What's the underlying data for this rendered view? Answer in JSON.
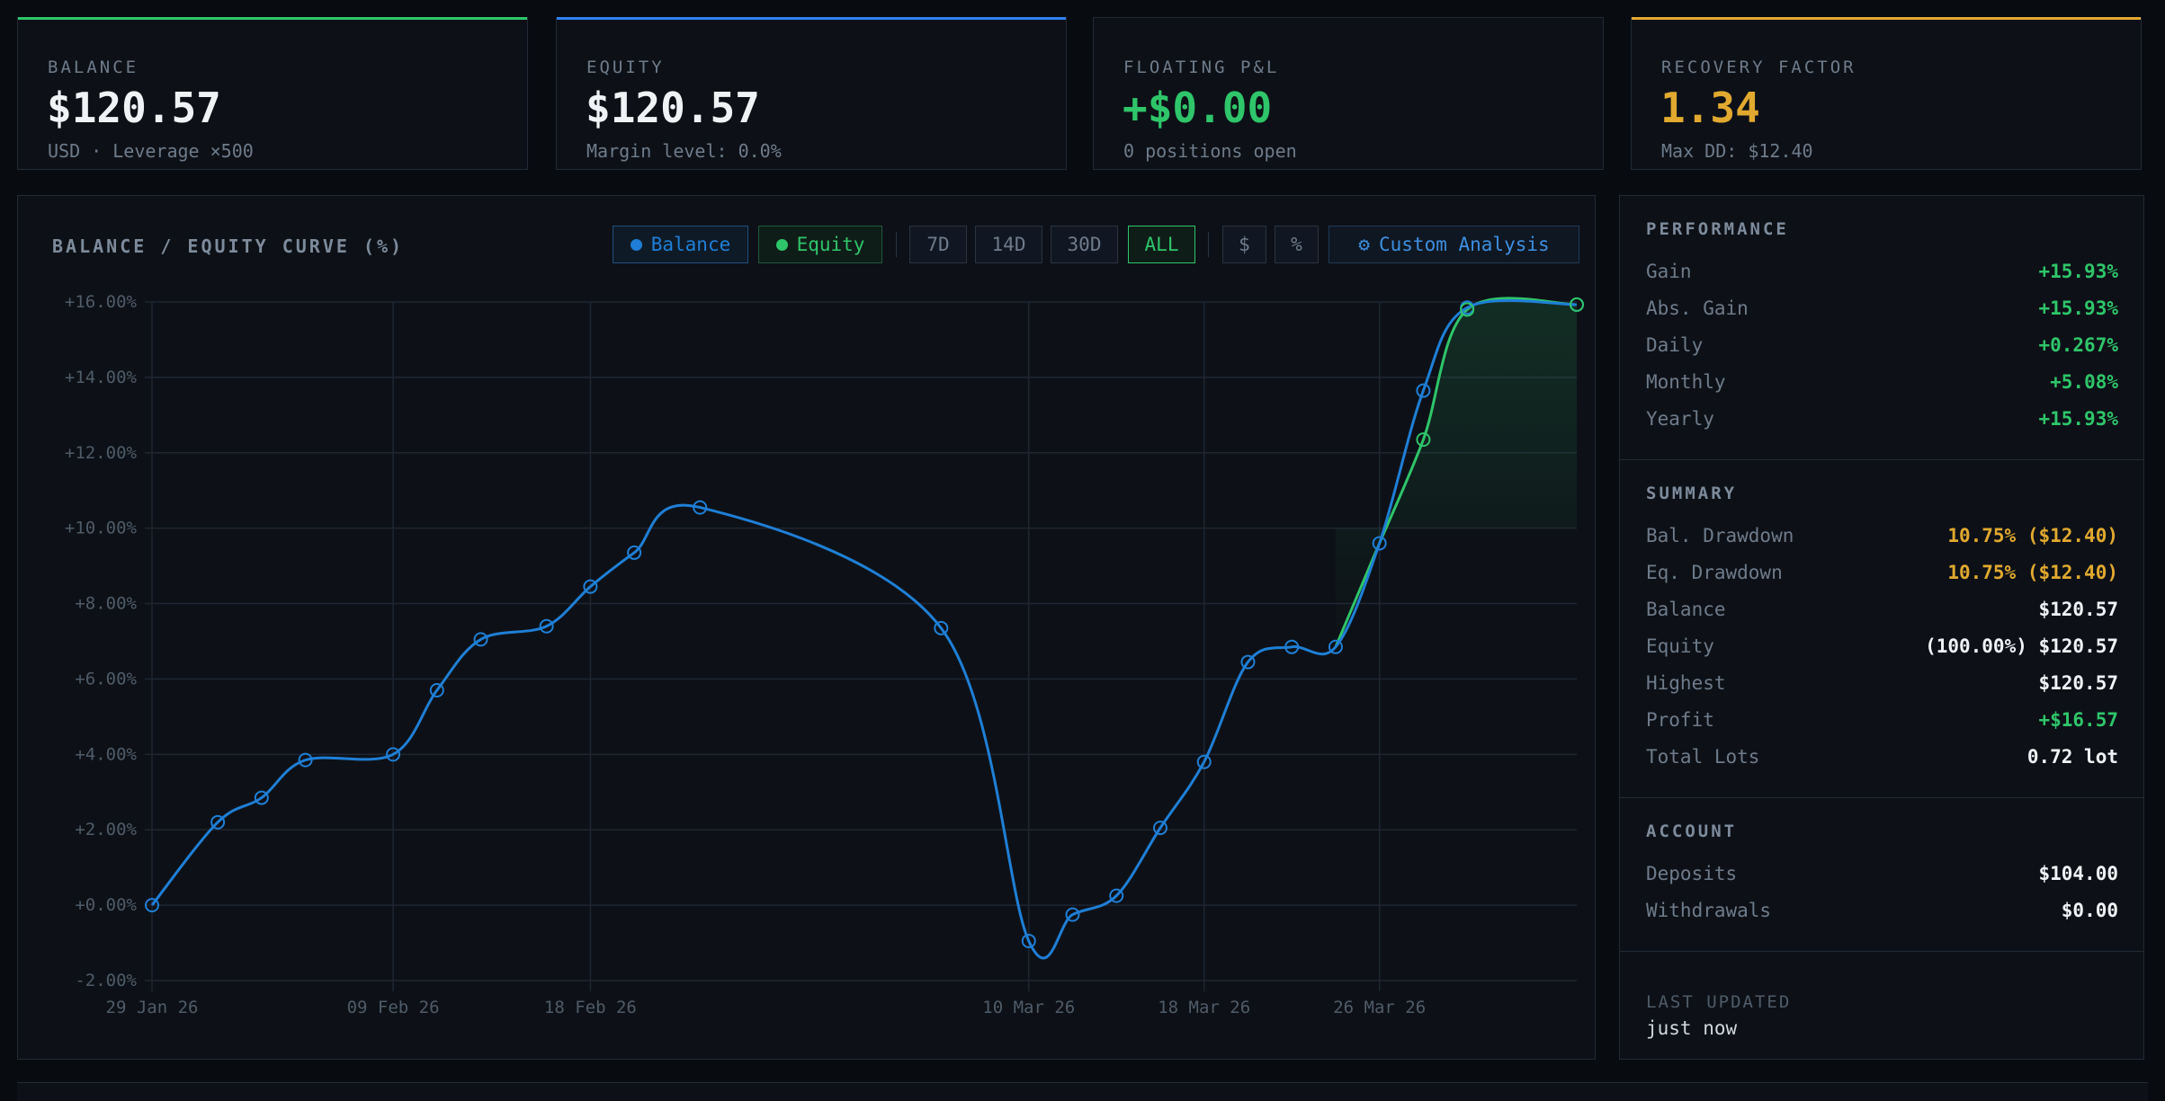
{
  "cards": [
    {
      "label": "BALANCE",
      "value": "$120.57",
      "sub": "USD · Leverage ×500",
      "accent": "#2fc56a",
      "value_color": "#f0f3f6"
    },
    {
      "label": "EQUITY",
      "value": "$120.57",
      "sub": "Margin level: 0.0%",
      "accent": "#2f81f7",
      "value_color": "#f0f3f6"
    },
    {
      "label": "FLOATING P&L",
      "value": "+$0.00",
      "sub": "0 positions open",
      "accent": "",
      "value_color": "#2fc56a"
    },
    {
      "label": "RECOVERY FACTOR",
      "value": "1.34",
      "sub": "Max DD: $12.40",
      "accent": "#e1a92f",
      "value_color": "#e1a92f"
    }
  ],
  "chart_panel": {
    "title": "BALANCE / EQUITY CURVE (%)",
    "legend_balance": "Balance",
    "legend_equity": "Equity",
    "ranges": [
      "7D",
      "14D",
      "30D",
      "ALL"
    ],
    "active_range": "ALL",
    "units": [
      "$",
      "%"
    ],
    "custom_icon": "gear-icon",
    "custom_label": "Custom Analysis",
    "balance_color": "#1f7fd6",
    "equity_color": "#2fc56a",
    "active_color": "#2fc56a"
  },
  "chart_data": {
    "type": "line",
    "title": "BALANCE / EQUITY CURVE (%)",
    "xlabel": "",
    "ylabel": "",
    "ylim": [
      -2,
      16
    ],
    "yticks": [
      "+16.00%",
      "+14.00%",
      "+12.00%",
      "+10.00%",
      "+8.00%",
      "+6.00%",
      "+4.00%",
      "+2.00%",
      "+0.00%",
      "-2.00%"
    ],
    "ytick_values": [
      16,
      14,
      12,
      10,
      8,
      6,
      4,
      2,
      0,
      -2
    ],
    "x_start": "2026-01-29",
    "x_end": "2026-04-04",
    "xticks": [
      {
        "date": "2026-01-29",
        "label": "29 Jan 26"
      },
      {
        "date": "2026-02-09",
        "label": "09 Feb 26"
      },
      {
        "date": "2026-02-18",
        "label": "18 Feb 26"
      },
      {
        "date": "2026-03-10",
        "label": "10 Mar 26"
      },
      {
        "date": "2026-03-18",
        "label": "18 Mar 26"
      },
      {
        "date": "2026-03-26",
        "label": "26 Mar 26"
      }
    ],
    "grid": true,
    "series": [
      {
        "name": "Balance",
        "points": [
          {
            "x": "2026-01-29",
            "y": 0.0
          },
          {
            "x": "2026-02-01",
            "y": 2.2
          },
          {
            "x": "2026-02-03",
            "y": 2.85
          },
          {
            "x": "2026-02-05",
            "y": 3.85
          },
          {
            "x": "2026-02-09",
            "y": 4.0
          },
          {
            "x": "2026-02-11",
            "y": 5.7
          },
          {
            "x": "2026-02-13",
            "y": 7.05
          },
          {
            "x": "2026-02-16",
            "y": 7.4
          },
          {
            "x": "2026-02-18",
            "y": 8.45
          },
          {
            "x": "2026-02-20",
            "y": 9.35
          },
          {
            "x": "2026-02-23",
            "y": 10.55
          },
          {
            "x": "2026-03-06",
            "y": 7.35
          },
          {
            "x": "2026-03-10",
            "y": -0.95
          },
          {
            "x": "2026-03-12",
            "y": -0.25
          },
          {
            "x": "2026-03-14",
            "y": 0.25
          },
          {
            "x": "2026-03-16",
            "y": 2.05
          },
          {
            "x": "2026-03-18",
            "y": 3.8
          },
          {
            "x": "2026-03-20",
            "y": 6.45
          },
          {
            "x": "2026-03-22",
            "y": 6.85
          },
          {
            "x": "2026-03-24",
            "y": 6.85
          },
          {
            "x": "2026-03-26",
            "y": 9.6
          },
          {
            "x": "2026-03-28",
            "y": 13.65
          },
          {
            "x": "2026-03-30",
            "y": 15.85
          },
          {
            "x": "2026-04-04",
            "y": 15.93
          }
        ]
      },
      {
        "name": "Equity",
        "points": [
          {
            "x": "2026-03-24",
            "y": 6.85
          },
          {
            "x": "2026-03-26",
            "y": 9.6
          },
          {
            "x": "2026-03-28",
            "y": 12.35
          },
          {
            "x": "2026-03-30",
            "y": 15.8
          },
          {
            "x": "2026-04-04",
            "y": 15.93
          }
        ]
      }
    ]
  },
  "performance": {
    "title": "PERFORMANCE",
    "rows": [
      {
        "k": "Gain",
        "v": "+15.93%",
        "c": "green"
      },
      {
        "k": "Abs. Gain",
        "v": "+15.93%",
        "c": "green"
      },
      {
        "k": "Daily",
        "v": "+0.267%",
        "c": "green"
      },
      {
        "k": "Monthly",
        "v": "+5.08%",
        "c": "green"
      },
      {
        "k": "Yearly",
        "v": "+15.93%",
        "c": "green"
      }
    ]
  },
  "summary": {
    "title": "SUMMARY",
    "rows": [
      {
        "k": "Bal. Drawdown",
        "v": "10.75% ($12.40)",
        "c": "amber"
      },
      {
        "k": "Eq. Drawdown",
        "v": "10.75% ($12.40)",
        "c": "amber"
      },
      {
        "k": "Balance",
        "v": "$120.57",
        "c": "white"
      },
      {
        "k": "Equity",
        "v": "(100.00%) $120.57",
        "c": "white"
      },
      {
        "k": "Highest",
        "v": "$120.57",
        "c": "white"
      },
      {
        "k": "Profit",
        "v": "+$16.57",
        "c": "green"
      },
      {
        "k": "Total Lots",
        "v": "0.72 lot",
        "c": "white"
      }
    ]
  },
  "account": {
    "title": "ACCOUNT",
    "rows": [
      {
        "k": "Deposits",
        "v": "$104.00",
        "c": "white"
      },
      {
        "k": "Withdrawals",
        "v": "$0.00",
        "c": "white"
      }
    ]
  },
  "last_updated": {
    "label": "LAST UPDATED",
    "value": "just now"
  }
}
